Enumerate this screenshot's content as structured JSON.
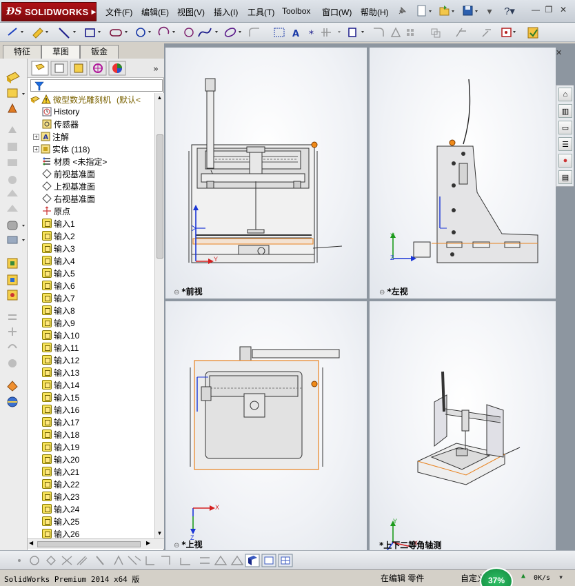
{
  "app": {
    "name": "SOLIDWORKS",
    "brand_color": "#a80f14"
  },
  "menu": {
    "items": [
      "文件(F)",
      "编辑(E)",
      "视图(V)",
      "插入(I)",
      "工具(T)",
      "Toolbox",
      "窗口(W)",
      "帮助(H)"
    ]
  },
  "tabs": [
    "特征",
    "草图",
    "钣金"
  ],
  "active_tab": "草图",
  "feature_tree": {
    "root": "微型数光雕刻机",
    "root_suffix": "(默认<",
    "nodes": [
      {
        "label": "History",
        "icon": "history-icon"
      },
      {
        "label": "传感器",
        "icon": "sensor-icon"
      },
      {
        "label": "注解",
        "icon": "annotation-icon",
        "expandable": true
      },
      {
        "label": "实体 (118)",
        "icon": "solid-bodies-icon",
        "expandable": true
      },
      {
        "label": "材质 <未指定>",
        "icon": "material-icon"
      },
      {
        "label": "前视基准面",
        "icon": "plane-icon"
      },
      {
        "label": "上视基准面",
        "icon": "plane-icon"
      },
      {
        "label": "右视基准面",
        "icon": "plane-icon"
      },
      {
        "label": "原点",
        "icon": "origin-icon"
      }
    ],
    "inputs": [
      "输入1",
      "输入2",
      "输入3",
      "输入4",
      "输入5",
      "输入6",
      "输入7",
      "输入8",
      "输入9",
      "输入10",
      "输入11",
      "输入12",
      "输入13",
      "输入14",
      "输入15",
      "输入16",
      "输入17",
      "输入18",
      "输入19",
      "输入20",
      "输入21",
      "输入22",
      "输入23",
      "输入24",
      "输入25",
      "输入26"
    ]
  },
  "viewports": [
    {
      "label": "*前视"
    },
    {
      "label": "*左视"
    },
    {
      "label": "*上视"
    },
    {
      "label": "*上下二等角轴测"
    }
  ],
  "axes": {
    "x": "X",
    "y": "Y",
    "z": "Z"
  },
  "status": {
    "version": "SolidWorks Premium 2014 x64 版",
    "mode": "在编辑 零件",
    "units": "自定义",
    "percent": "37%",
    "net": "0K/s"
  },
  "colors": {
    "highlight": "#e8821e",
    "axis_x": "#d42020",
    "axis_y": "#1c9b1c",
    "axis_z": "#1a35d6"
  }
}
